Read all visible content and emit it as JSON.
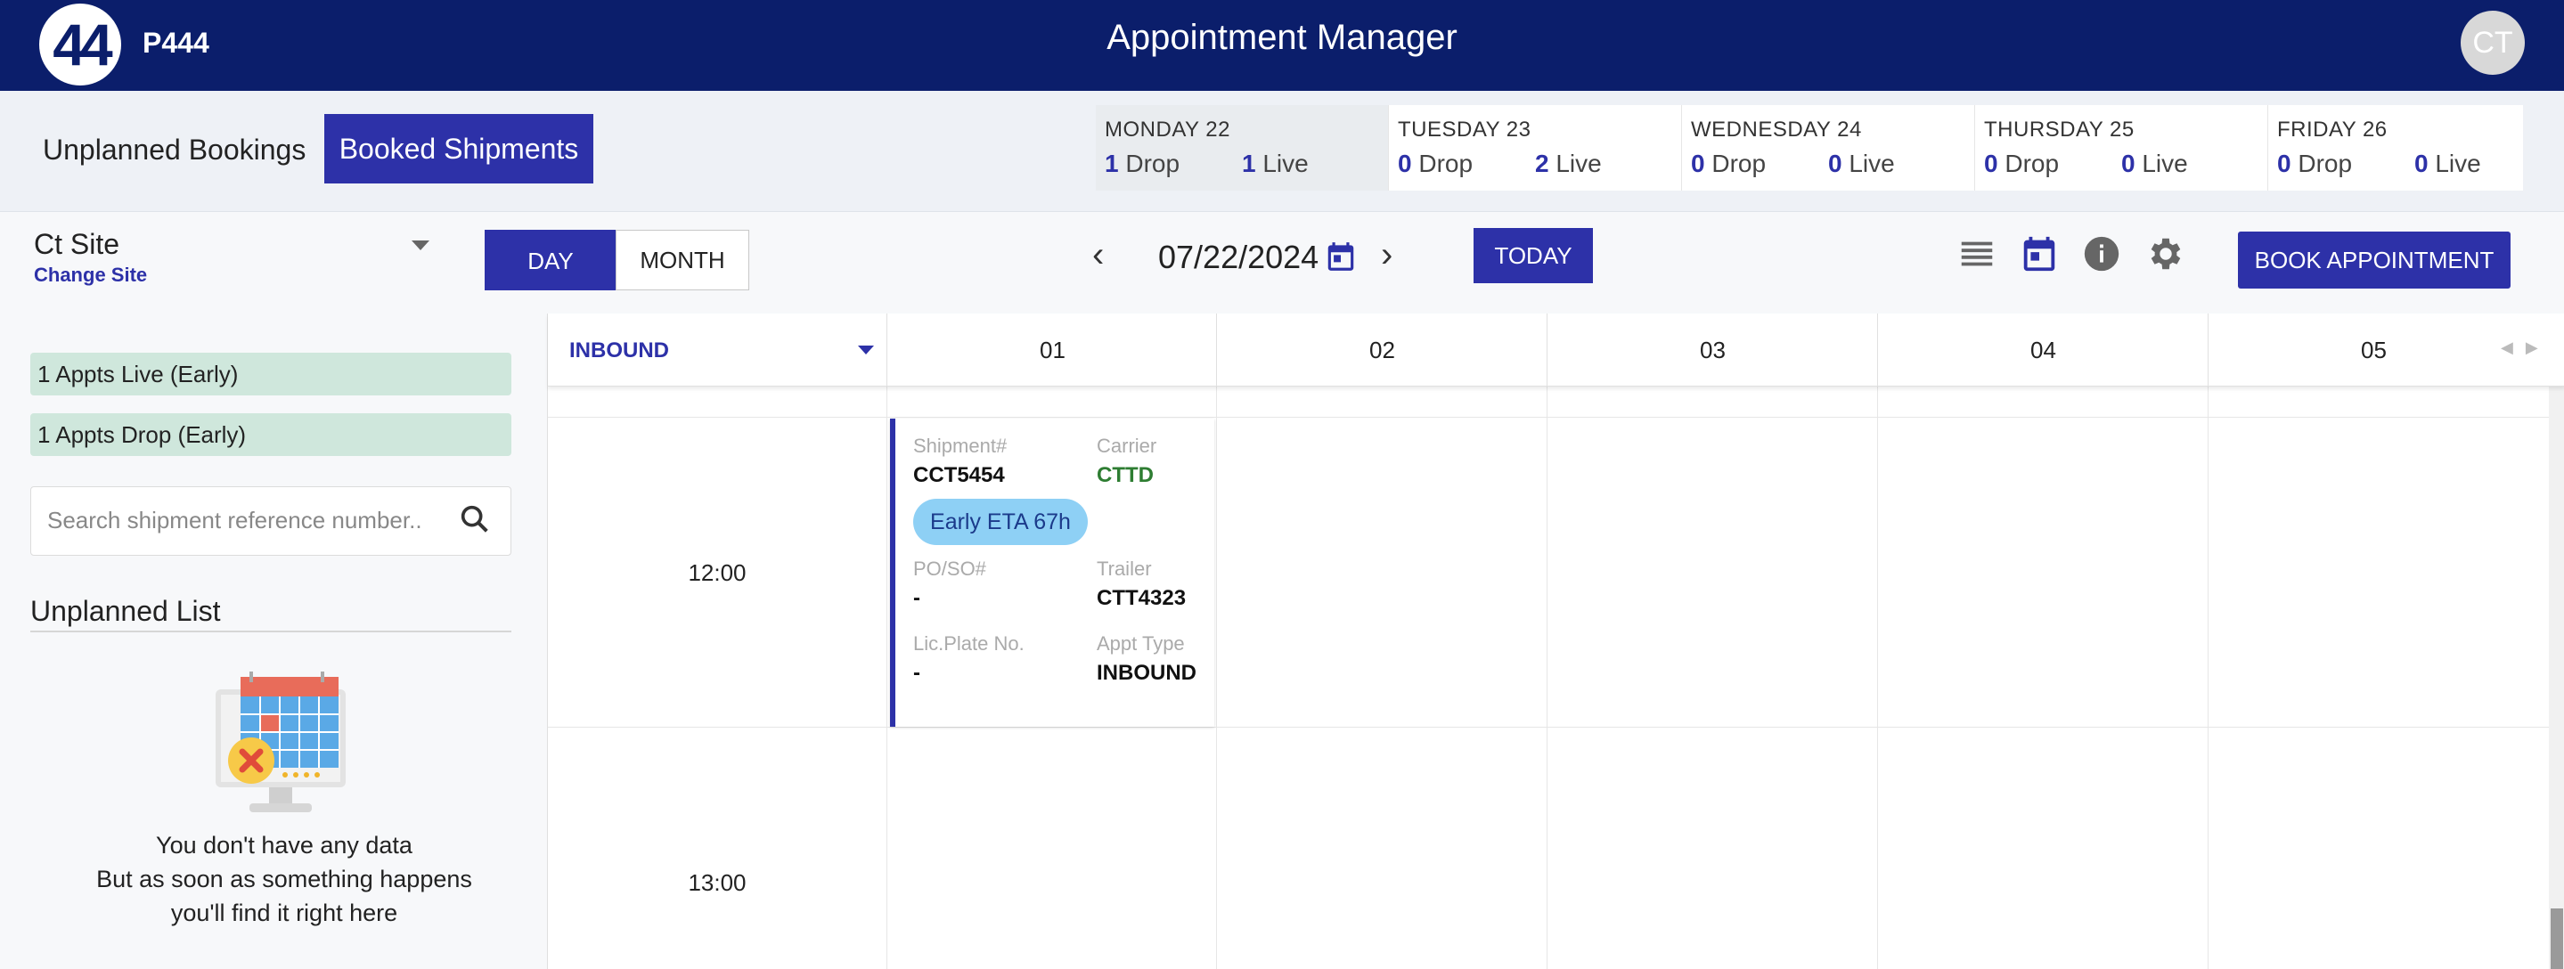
{
  "header": {
    "logo_text": "44",
    "brand": "P444",
    "title": "Appointment Manager",
    "avatar_initials": "CT"
  },
  "tabs": {
    "unplanned": "Unplanned Bookings",
    "booked": "Booked Shipments"
  },
  "week": [
    {
      "name": "MONDAY 22",
      "drop": "1",
      "live": "1",
      "active": true
    },
    {
      "name": "TUESDAY 23",
      "drop": "0",
      "live": "2",
      "active": false
    },
    {
      "name": "WEDNESDAY 24",
      "drop": "0",
      "live": "0",
      "active": false
    },
    {
      "name": "THURSDAY 25",
      "drop": "0",
      "live": "0",
      "active": false
    },
    {
      "name": "FRIDAY 26",
      "drop": "0",
      "live": "0",
      "active": false
    }
  ],
  "labels": {
    "drop": "Drop",
    "live": "Live"
  },
  "site": {
    "name": "Ct Site",
    "change": "Change Site"
  },
  "view": {
    "day": "DAY",
    "month": "MONTH"
  },
  "date_nav": {
    "date": "07/22/2024",
    "today": "TODAY"
  },
  "toolbar": {
    "book": "BOOK APPOINTMENT"
  },
  "left": {
    "chips": [
      "1 Appts Live (Early)",
      "1 Appts Drop (Early)"
    ],
    "search_placeholder": "Search shipment reference number..",
    "unplanned_title": "Unplanned List",
    "empty_line1": "You don't have any data",
    "empty_line2": "But as soon as something happens",
    "empty_line3": "you'll find it right here"
  },
  "grid": {
    "filter": "INBOUND",
    "columns": [
      "01",
      "02",
      "03",
      "04",
      "05"
    ],
    "times": [
      "12:00",
      "13:00"
    ]
  },
  "appointment": {
    "shipment_label": "Shipment#",
    "shipment": "CCT5454",
    "carrier_label": "Carrier",
    "carrier": "CTTD",
    "eta": "Early ETA 67h",
    "po_label": "PO/SO#",
    "po": "-",
    "trailer_label": "Trailer",
    "trailer": "CTT4323",
    "plate_label": "Lic.Plate No.",
    "plate": "-",
    "type_label": "Appt Type",
    "type": "INBOUND"
  },
  "colors": {
    "brand_navy": "#0b1e6b",
    "accent": "#2d31a8",
    "chip_green": "#cfe7dc",
    "eta_blue": "#8ed0f5",
    "carrier_green": "#2e7d32"
  }
}
